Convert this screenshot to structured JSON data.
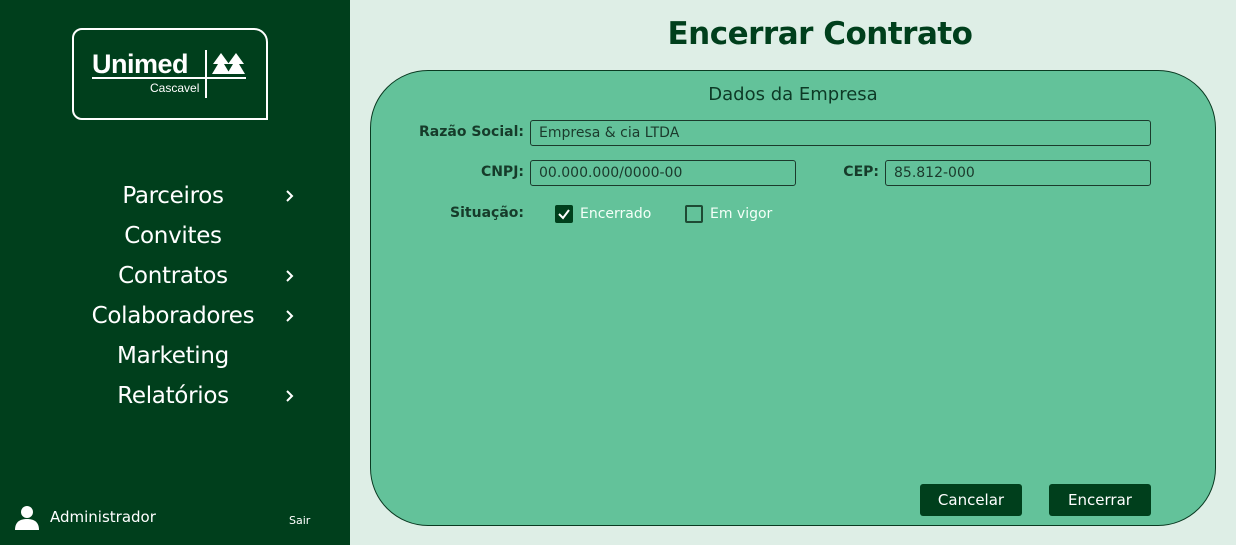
{
  "brand": {
    "name": "Unimed",
    "city": "Cascavel"
  },
  "sidebar": {
    "items": [
      {
        "label": "Parceiros",
        "has_submenu": true
      },
      {
        "label": "Convites",
        "has_submenu": false
      },
      {
        "label": "Contratos",
        "has_submenu": true
      },
      {
        "label": "Colaboradores",
        "has_submenu": true
      },
      {
        "label": "Marketing",
        "has_submenu": false
      },
      {
        "label": "Relatórios",
        "has_submenu": true
      }
    ],
    "user_name": "Administrador",
    "logout_label": "Sair"
  },
  "page": {
    "title": "Encerrar Contrato"
  },
  "form": {
    "section_title": "Dados da Empresa",
    "razao_social": {
      "label": "Razão Social:",
      "value": "Empresa & cia LTDA"
    },
    "cnpj": {
      "label": "CNPJ:",
      "value": "00.000.000/0000-00"
    },
    "cep": {
      "label": "CEP:",
      "value": "85.812-000"
    },
    "situacao": {
      "label": "Situação:",
      "options": [
        {
          "label": "Encerrado",
          "checked": true
        },
        {
          "label": "Em vigor",
          "checked": false
        }
      ]
    },
    "cancel_label": "Cancelar",
    "submit_label": "Encerrar"
  },
  "colors": {
    "sidebar_bg": "#003f1c",
    "page_bg": "#deeee6",
    "card_bg": "#63c29a",
    "button_bg": "#003f1c"
  }
}
